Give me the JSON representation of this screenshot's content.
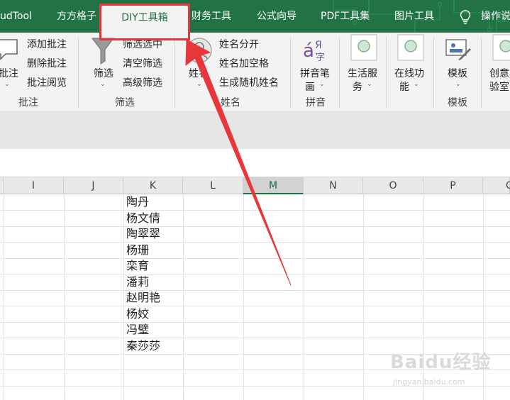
{
  "colors": {
    "ribbon_green": "#217346",
    "highlight_red": "#e8373b",
    "active_tab_text": "#1e6e3f"
  },
  "tabs": [
    {
      "label": "udTool"
    },
    {
      "label": "方方格子"
    },
    {
      "label": "DIY工具箱",
      "active": true
    },
    {
      "label": "财务工具"
    },
    {
      "label": "公式向导"
    },
    {
      "label": "PDF工具集"
    },
    {
      "label": "图片工具"
    }
  ],
  "tell_me": {
    "label": "操作说",
    "icon": "lightbulb-icon"
  },
  "ribbon": {
    "comments": {
      "group_name": "批注",
      "big_button": {
        "label": "批注",
        "icon": "comment-icon"
      },
      "items": [
        "添加批注",
        "删除批注",
        "批注阅览"
      ]
    },
    "filter": {
      "group_name": "筛选",
      "big_button": {
        "label": "筛选",
        "icon": "funnel-icon"
      },
      "items": [
        "筛选选中",
        "清空筛选",
        "高级筛选"
      ]
    },
    "name": {
      "group_name": "姓名",
      "big_button": {
        "label": "姓名",
        "icon": "person-icon"
      },
      "items": [
        "姓名分开",
        "姓名加空格",
        "生成随机姓名"
      ]
    },
    "pinyin": {
      "group_name": "拼音",
      "big_button": {
        "label_line1": "拼音笔",
        "label_line2": "画",
        "icon": "pinyin-icon"
      }
    },
    "life": {
      "label_line1": "生活服",
      "label_line2": "务",
      "icon": "circle-icon"
    },
    "online": {
      "label_line1": "在线功",
      "label_line2": "能",
      "icon": "circle-icon"
    },
    "template": {
      "group_name": "模板",
      "big_button": {
        "label": "模板",
        "icon": "template-icon"
      }
    },
    "creative": {
      "label_line1": "创意",
      "label_line2": "验室",
      "icon": "circle-icon"
    }
  },
  "columns": [
    "I",
    "J",
    "K",
    "L",
    "M",
    "N",
    "O",
    "P",
    "Q"
  ],
  "selected_column": "M",
  "cells_K": [
    "陶丹",
    "杨文倩",
    "陶翠翠",
    "杨珊",
    "栾育",
    "潘莉",
    "赵明艳",
    "杨姣",
    "冯璧",
    "秦莎莎"
  ],
  "watermark": {
    "logo": "Baidu经验",
    "url": "jingyan.baidu.com"
  }
}
